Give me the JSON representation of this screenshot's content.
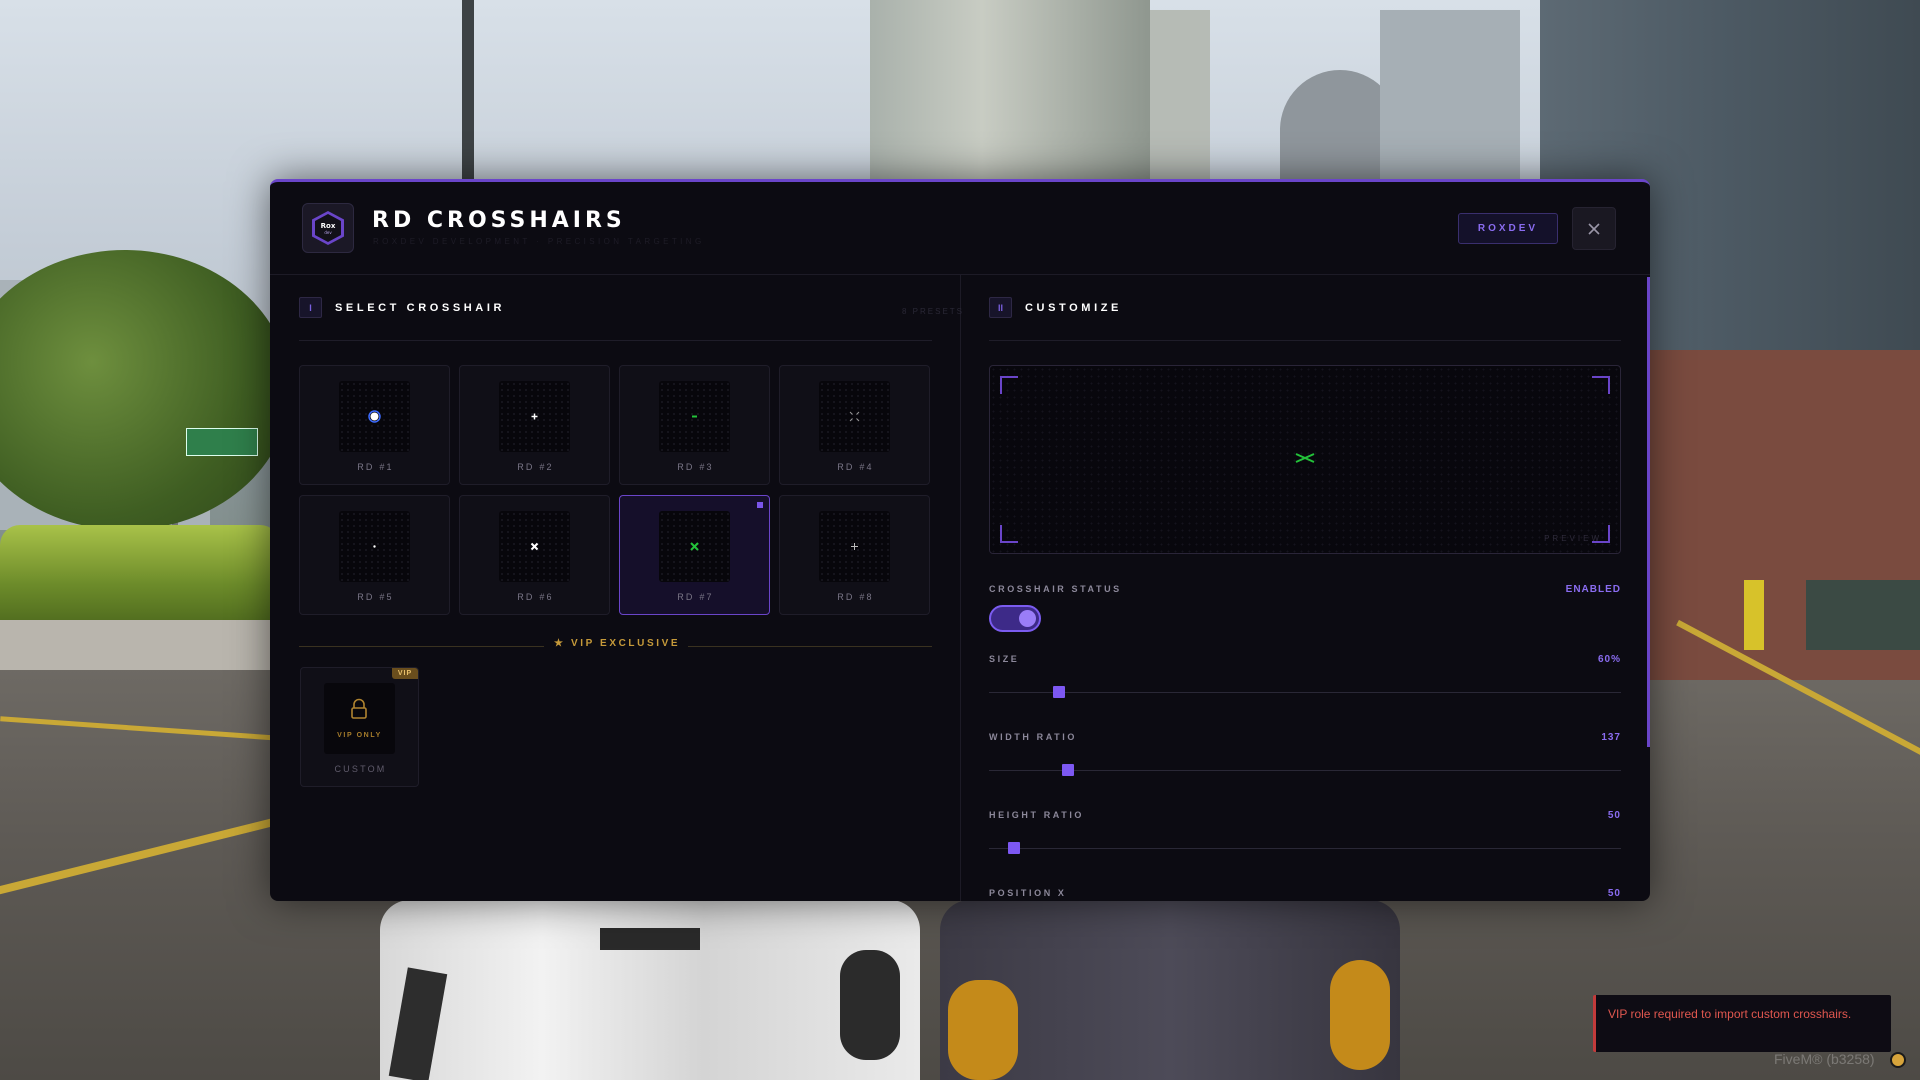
{
  "app": {
    "logo_text": "Rox",
    "logo_subtext": "dev",
    "title": "RD CROSSHAIRS",
    "subtitle": "ROXDEV DEVELOPMENT · PRECISION TARGETING",
    "brand_button": "ROXDEV",
    "close_icon": "close-icon"
  },
  "left": {
    "section_number": "I",
    "section_title": "SELECT CROSSHAIR",
    "presets_count": "8 PRESETS",
    "presets": [
      {
        "label": "RD #1",
        "icon": "dot-crosshair",
        "selected": false,
        "color": "#3d6bff"
      },
      {
        "label": "RD #2",
        "icon": "small-plus-crosshair",
        "selected": false,
        "color": "#ffffff"
      },
      {
        "label": "RD #3",
        "icon": "green-dash-crosshair",
        "selected": false,
        "color": "#23c23a"
      },
      {
        "label": "RD #4",
        "icon": "split-corner-crosshair",
        "selected": false,
        "color": "#9a9a9a"
      },
      {
        "label": "RD #5",
        "icon": "tiny-dot-crosshair",
        "selected": false,
        "color": "#ffffff"
      },
      {
        "label": "RD #6",
        "icon": "x-crosshair",
        "selected": false,
        "color": "#ffffff"
      },
      {
        "label": "RD #7",
        "icon": "green-x-crosshair",
        "selected": true,
        "color": "#23c23a"
      },
      {
        "label": "RD #8",
        "icon": "thin-plus-crosshair",
        "selected": false,
        "color": "#bbbbbb"
      }
    ],
    "vip_header": "★ VIP EXCLUSIVE",
    "vip_card": {
      "badge": "VIP",
      "lock_icon": "lock-icon",
      "locked_text": "VIP ONLY",
      "label": "CUSTOM"
    }
  },
  "right": {
    "section_number": "II",
    "section_title": "CUSTOMIZE",
    "preview_label": "PREVIEW",
    "status": {
      "label": "CROSSHAIR STATUS",
      "value": "ENABLED",
      "on": true
    },
    "sliders": [
      {
        "label": "SIZE",
        "value": "60%",
        "level": 0.11
      },
      {
        "label": "WIDTH RATIO",
        "value": "137",
        "level": 0.125
      },
      {
        "label": "HEIGHT RATIO",
        "value": "50",
        "level": 0.04
      },
      {
        "label": "POSITION X",
        "value": "50"
      }
    ],
    "accent_color": "#7d58f2"
  },
  "toast": {
    "message": "VIP role required to import custom crosshairs."
  },
  "overlay": {
    "fivem_text": "FiveM® (b3258)"
  }
}
